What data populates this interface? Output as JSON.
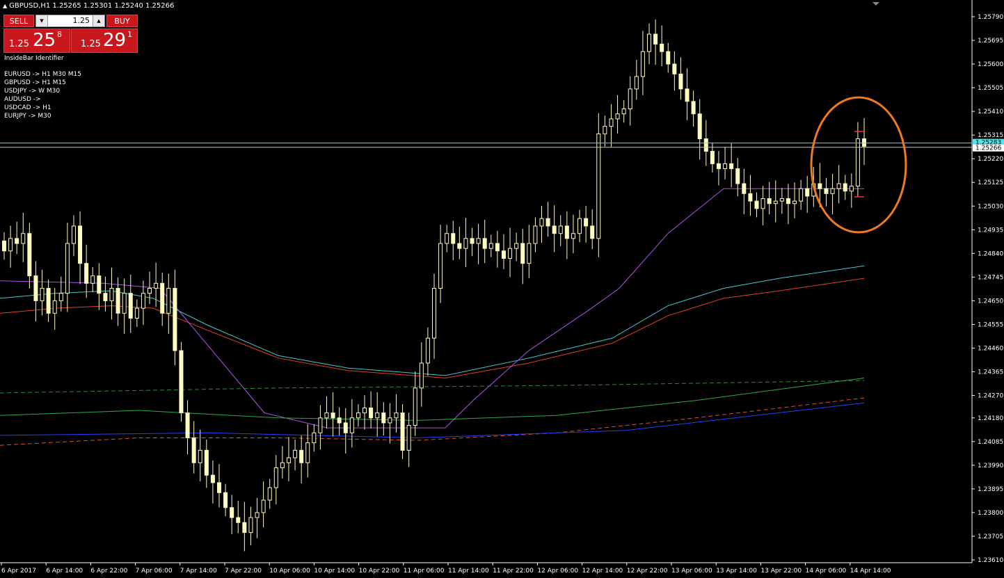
{
  "header": {
    "symbol_line": "GBPUSD,H1  1.25265 1.25301 1.25240 1.25266"
  },
  "trade_panel": {
    "sell_label": "SELL",
    "buy_label": "BUY",
    "lot_value": "1.25",
    "bid": {
      "prefix": "1.25",
      "big": "25",
      "pip": "8"
    },
    "ask": {
      "prefix": "1.25",
      "big": "29",
      "pip": "1"
    }
  },
  "indicator": {
    "title": "InsideBar Identifier",
    "lines": [
      "EURUSD -> H1  M30  M15",
      "GBPUSD -> H1  M15",
      "USDJPY -> W  M30",
      "AUDUSD ->",
      "USDCAD -> H1",
      "EURJPY -> M30"
    ]
  },
  "colors": {
    "bar": "#fffbbf",
    "cyan": "#5ee0e6",
    "orange_ellipse": "#f07a1f",
    "red": "#ff3333",
    "purple": "#b050f0",
    "ma_cyan": "#46c8d0",
    "ma_red": "#e0402a",
    "ma_green_dash": "#2a8a3a",
    "ma_green": "#2ea84a",
    "ma_orange_dash": "#e0502a",
    "ma_blue": "#2a3cff"
  },
  "chart_data": {
    "type": "candlestick",
    "ylim": [
      1.2361,
      1.259
    ],
    "y_ticks": [
      "1.25790",
      "1.25695",
      "1.25600",
      "1.25505",
      "1.25410",
      "1.25315",
      "1.25220",
      "1.25125",
      "1.25030",
      "1.24935",
      "1.24840",
      "1.24745",
      "1.24650",
      "1.24555",
      "1.24460",
      "1.24365",
      "1.24270",
      "1.24180",
      "1.24085",
      "1.23990",
      "1.23895",
      "1.23800",
      "1.23705",
      "1.23610"
    ],
    "x_ticks": [
      "6 Apr 2017",
      "6 Apr 14:00",
      "6 Apr 22:00",
      "7 Apr 06:00",
      "7 Apr 14:00",
      "7 Apr 22:00",
      "10 Apr 06:00",
      "10 Apr 14:00",
      "10 Apr 22:00",
      "11 Apr 06:00",
      "11 Apr 14:00",
      "11 Apr 22:00",
      "12 Apr 06:00",
      "12 Apr 14:00",
      "12 Apr 22:00",
      "13 Apr 06:00",
      "13 Apr 14:00",
      "13 Apr 22:00",
      "14 Apr 06:00",
      "14 Apr 14:00"
    ],
    "price_labels": {
      "ask": "1.25283",
      "bid": "1.25266"
    },
    "ask_line": 1.25283,
    "bid_line": 1.25266,
    "closes": [
      1.2485,
      1.249,
      1.2488,
      1.2492,
      1.2475,
      1.2465,
      1.247,
      1.246,
      1.2465,
      1.2468,
      1.2488,
      1.2495,
      1.248,
      1.2472,
      1.2475,
      1.2468,
      1.2465,
      1.247,
      1.246,
      1.2468,
      1.2458,
      1.2462,
      1.2468,
      1.247,
      1.2472,
      1.246,
      1.247,
      1.2445,
      1.242,
      1.241,
      1.24,
      1.2405,
      1.2395,
      1.2392,
      1.2388,
      1.2382,
      1.2378,
      1.2376,
      1.2372,
      1.2378,
      1.238,
      1.2385,
      1.239,
      1.2398,
      1.24,
      1.2402,
      1.2405,
      1.24,
      1.2408,
      1.2412,
      1.2418,
      1.242,
      1.2418,
      1.2416,
      1.2412,
      1.2418,
      1.242,
      1.2422,
      1.2418,
      1.242,
      1.2416,
      1.2418,
      1.242,
      1.2405,
      1.2415,
      1.243,
      1.244,
      1.245,
      1.247,
      1.2488,
      1.2492,
      1.2488,
      1.2486,
      1.249,
      1.2488,
      1.249,
      1.2486,
      1.2488,
      1.2485,
      1.2482,
      1.2486,
      1.2488,
      1.248,
      1.2488,
      1.2495,
      1.2498,
      1.2495,
      1.2492,
      1.2495,
      1.249,
      1.2492,
      1.2498,
      1.2495,
      1.249,
      1.2532,
      1.2535,
      1.2538,
      1.254,
      1.2542,
      1.255,
      1.2555,
      1.2565,
      1.2572,
      1.2568,
      1.2565,
      1.256,
      1.2556,
      1.255,
      1.2545,
      1.254,
      1.253,
      1.2525,
      1.252,
      1.2518,
      1.252,
      1.2518,
      1.2512,
      1.2508,
      1.2505,
      1.2502,
      1.2506,
      1.2504,
      1.2505,
      1.2506,
      1.2504,
      1.2505,
      1.251,
      1.2507,
      1.2512,
      1.251,
      1.2508,
      1.251,
      1.2512,
      1.2509,
      1.2511,
      1.253,
      1.2527
    ]
  }
}
